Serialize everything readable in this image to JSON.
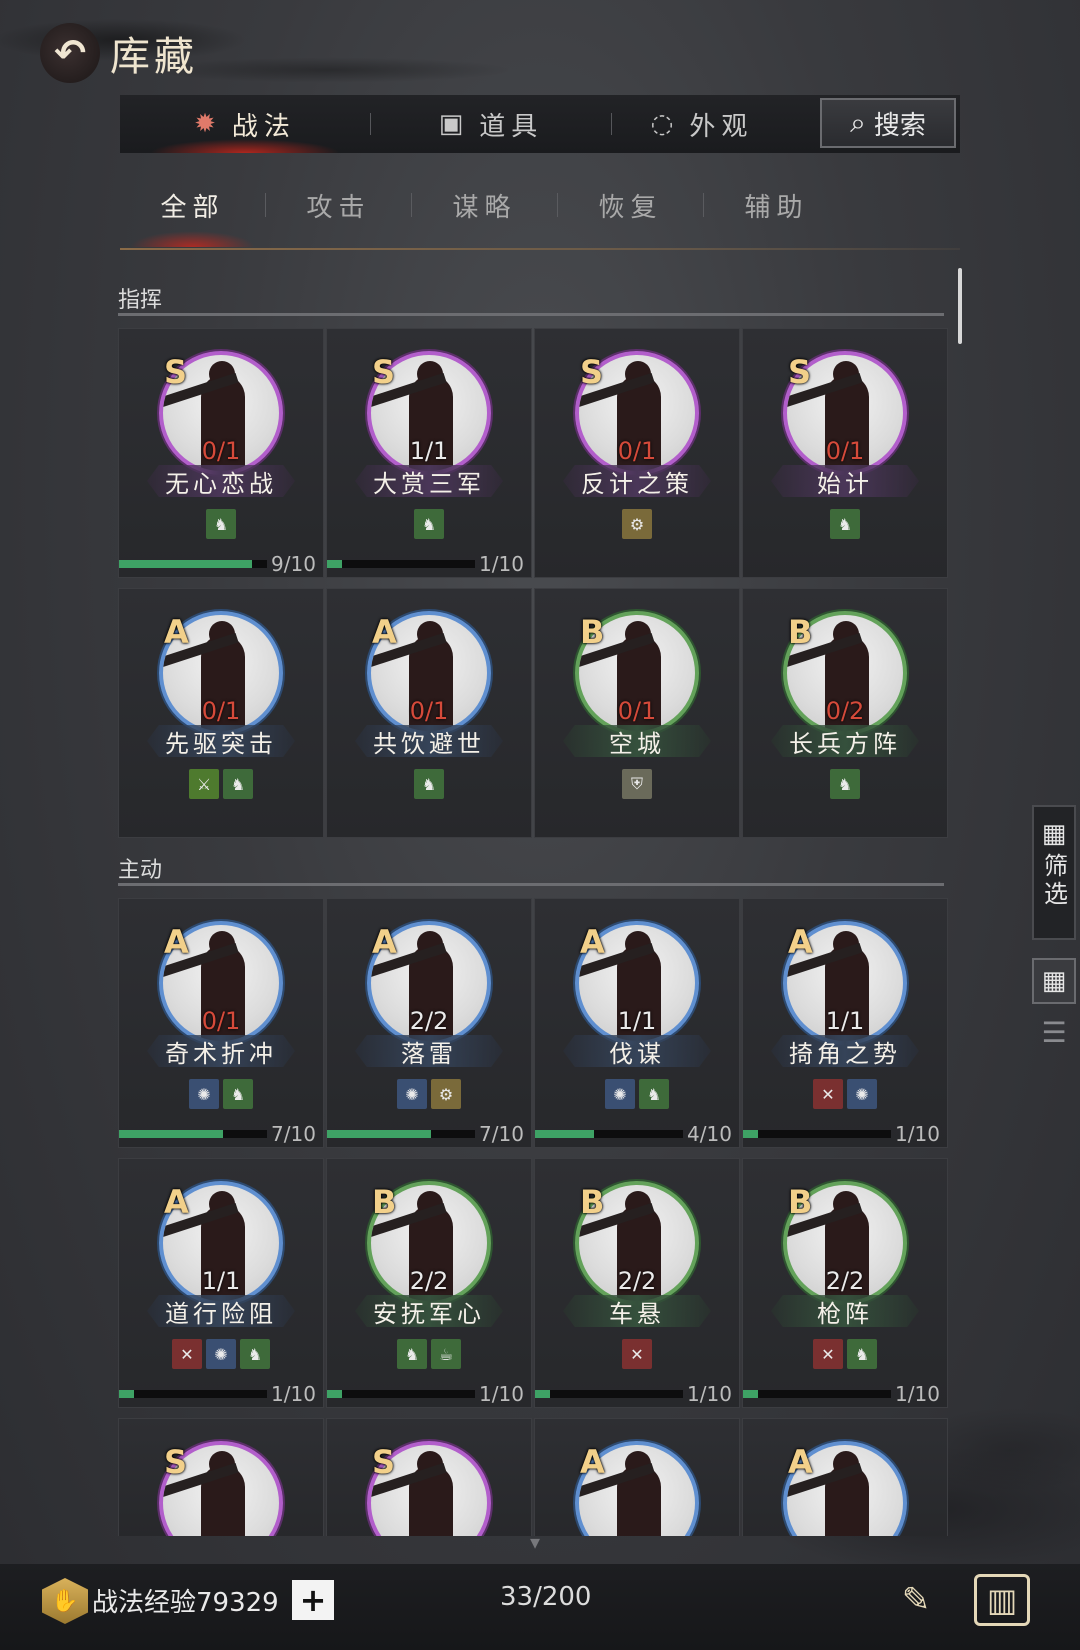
{
  "header": {
    "title": "库藏",
    "back_icon": "back-arrow-icon"
  },
  "main_tabs": [
    {
      "label": "战法",
      "icon": "scroll-icon",
      "active": true
    },
    {
      "label": "道具",
      "icon": "chest-icon",
      "active": false
    },
    {
      "label": "外观",
      "icon": "swirl-icon",
      "active": false
    }
  ],
  "search": {
    "label": "搜索",
    "icon": "magnifier-icon"
  },
  "sub_tabs": [
    {
      "label": "全部",
      "active": true
    },
    {
      "label": "攻击",
      "active": false
    },
    {
      "label": "谋略",
      "active": false
    },
    {
      "label": "恢复",
      "active": false
    },
    {
      "label": "辅助",
      "active": false
    }
  ],
  "sections": [
    {
      "title": "指挥",
      "cards": [
        {
          "grade": "S",
          "count": "0/1",
          "name": "无心恋战",
          "tags": [
            "troop"
          ],
          "progress": {
            "text": "9/10",
            "fraction": 0.9
          }
        },
        {
          "grade": "S",
          "count": "1/1",
          "name": "大赏三军",
          "tags": [
            "troop"
          ],
          "progress": {
            "text": "1/10",
            "fraction": 0.1
          }
        },
        {
          "grade": "S",
          "count": "0/1",
          "name": "反计之策",
          "tags": [
            "ctrl"
          ],
          "progress": null
        },
        {
          "grade": "S",
          "count": "0/1",
          "name": "始计",
          "tags": [
            "troop"
          ],
          "progress": null
        },
        {
          "grade": "A",
          "count": "0/1",
          "name": "先驱突击",
          "tags": [
            "atk",
            "troop"
          ],
          "progress": null
        },
        {
          "grade": "A",
          "count": "0/1",
          "name": "共饮避世",
          "tags": [
            "troop"
          ],
          "progress": null
        },
        {
          "grade": "B",
          "count": "0/1",
          "name": "空城",
          "tags": [
            "shield"
          ],
          "progress": null
        },
        {
          "grade": "B",
          "count": "0/2",
          "name": "长兵方阵",
          "tags": [
            "troop"
          ],
          "progress": null
        }
      ]
    },
    {
      "title": "主动",
      "cards": [
        {
          "grade": "A",
          "count": "0/1",
          "name": "奇术折冲",
          "tags": [
            "intel",
            "troop"
          ],
          "progress": {
            "text": "7/10",
            "fraction": 0.7
          }
        },
        {
          "grade": "A",
          "count": "2/2",
          "name": "落雷",
          "tags": [
            "intel",
            "ctrl"
          ],
          "progress": {
            "text": "7/10",
            "fraction": 0.7
          }
        },
        {
          "grade": "A",
          "count": "1/1",
          "name": "伐谋",
          "tags": [
            "intel",
            "troop"
          ],
          "progress": {
            "text": "4/10",
            "fraction": 0.4
          }
        },
        {
          "grade": "A",
          "count": "1/1",
          "name": "掎角之势",
          "tags": [
            "cross",
            "intel"
          ],
          "progress": {
            "text": "1/10",
            "fraction": 0.1
          }
        },
        {
          "grade": "A",
          "count": "1/1",
          "name": "道行险阻",
          "tags": [
            "cross",
            "intel",
            "troop"
          ],
          "progress": {
            "text": "1/10",
            "fraction": 0.1
          }
        },
        {
          "grade": "B",
          "count": "2/2",
          "name": "安抚军心",
          "tags": [
            "troop",
            "heal"
          ],
          "progress": {
            "text": "1/10",
            "fraction": 0.1
          }
        },
        {
          "grade": "B",
          "count": "2/2",
          "name": "车悬",
          "tags": [
            "cross"
          ],
          "progress": {
            "text": "1/10",
            "fraction": 0.1
          }
        },
        {
          "grade": "B",
          "count": "2/2",
          "name": "枪阵",
          "tags": [
            "cross",
            "troop"
          ],
          "progress": {
            "text": "1/10",
            "fraction": 0.1
          }
        },
        {
          "grade": "S",
          "count": "",
          "name": "",
          "tags": [],
          "progress": null,
          "partial": true
        },
        {
          "grade": "S",
          "count": "",
          "name": "",
          "tags": [],
          "progress": null,
          "partial": true
        },
        {
          "grade": "A",
          "count": "",
          "name": "",
          "tags": [],
          "progress": null,
          "partial": true
        },
        {
          "grade": "A",
          "count": "",
          "name": "",
          "tags": [],
          "progress": null,
          "partial": true
        }
      ]
    }
  ],
  "side": {
    "filter_label": "筛选",
    "filter_icon": "grid-filter-icon",
    "grid_view_icon": "grid-view-icon",
    "list_view_icon": "list-view-icon"
  },
  "footer": {
    "exp_label": "战法经验",
    "exp_value": "79329",
    "plus": "+",
    "capacity": "33/200",
    "left_icon": "book-quill-icon",
    "right_icon": "scroll-case-icon"
  },
  "colors": {
    "grade_S": "#b25ecb",
    "grade_A": "#5f8fd0",
    "grade_B": "#63a25a",
    "progress": "#3ea265",
    "zero_count": "#d54a3a"
  }
}
